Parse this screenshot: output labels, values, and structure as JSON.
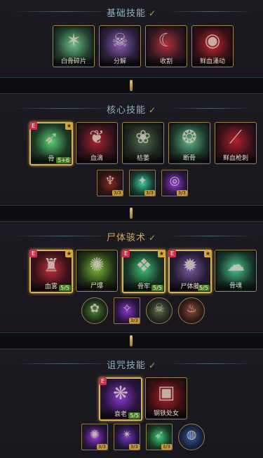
{
  "sections": {
    "basic": {
      "title": "基础技能",
      "skills": [
        {
          "label": "白骨碎片",
          "icon": "bone-splinters-icon"
        },
        {
          "label": "分解",
          "icon": "decompose-icon"
        },
        {
          "label": "收割",
          "icon": "reap-icon"
        },
        {
          "label": "鲜血涌动",
          "icon": "blood-surge-icon"
        }
      ]
    },
    "core": {
      "title": "核心技能",
      "skills": [
        {
          "label": "骨",
          "icon": "bone-spear-icon",
          "level": "5+6",
          "badge_e": "E",
          "star": "★"
        },
        {
          "label": "血滴",
          "icon": "blood-drop-icon"
        },
        {
          "label": "枯萎",
          "icon": "blight-icon"
        },
        {
          "label": "断骨",
          "icon": "broken-bone-icon"
        },
        {
          "label": "鲜血枪刺",
          "icon": "blood-lance-icon"
        }
      ],
      "modifiers": [
        {
          "icon": "modifier-red-icon",
          "level": "3/3"
        },
        {
          "icon": "modifier-teal-icon",
          "level": "3/3"
        },
        {
          "icon": "modifier-purple-icon",
          "level": "3/3"
        }
      ]
    },
    "corpse": {
      "title": "尸体骇术",
      "skills": [
        {
          "label": "血雾",
          "icon": "blood-mist-icon",
          "level": "5/5",
          "badge_e": "E",
          "star": "★"
        },
        {
          "label": "尸爆",
          "icon": "corpse-explosion-icon"
        },
        {
          "label": "骨牢",
          "icon": "bone-prison-icon",
          "level": "5/5",
          "badge_e": "E",
          "star": "★"
        },
        {
          "label": "尸体藤",
          "icon": "corpse-tendrils-icon",
          "level": "5/5",
          "badge_e": "E",
          "star": "★"
        },
        {
          "label": "骨魂",
          "icon": "bone-spirit-icon"
        }
      ],
      "modifiers": [
        {
          "icon": "modifier-green-icon",
          "level": ""
        },
        {
          "icon": "modifier-violet-icon",
          "level": "3/3"
        },
        {
          "icon": "modifier-skeleton-icon",
          "level": ""
        },
        {
          "icon": "modifier-flesh-icon",
          "level": ""
        }
      ]
    },
    "curse": {
      "title": "诅咒技能",
      "skills": [
        {
          "label": "衰老",
          "icon": "decrepify-icon",
          "level": "5/5",
          "badge_e": "E"
        },
        {
          "label": "钢铁处女",
          "icon": "iron-maiden-icon"
        }
      ],
      "modifiers": [
        {
          "icon": "modifier-purple-icon",
          "level": "3/3"
        },
        {
          "icon": "modifier-violet-icon",
          "level": "3/3"
        },
        {
          "icon": "modifier-green-icon",
          "level": "3/3"
        },
        {
          "icon": "modifier-blue-icon",
          "level": ""
        }
      ]
    }
  },
  "colors": {
    "frame_gold": "#9c8650",
    "check_green": "#7dbb55",
    "title_blue": "#8fb0c0",
    "badge_red": "#c8314a"
  }
}
